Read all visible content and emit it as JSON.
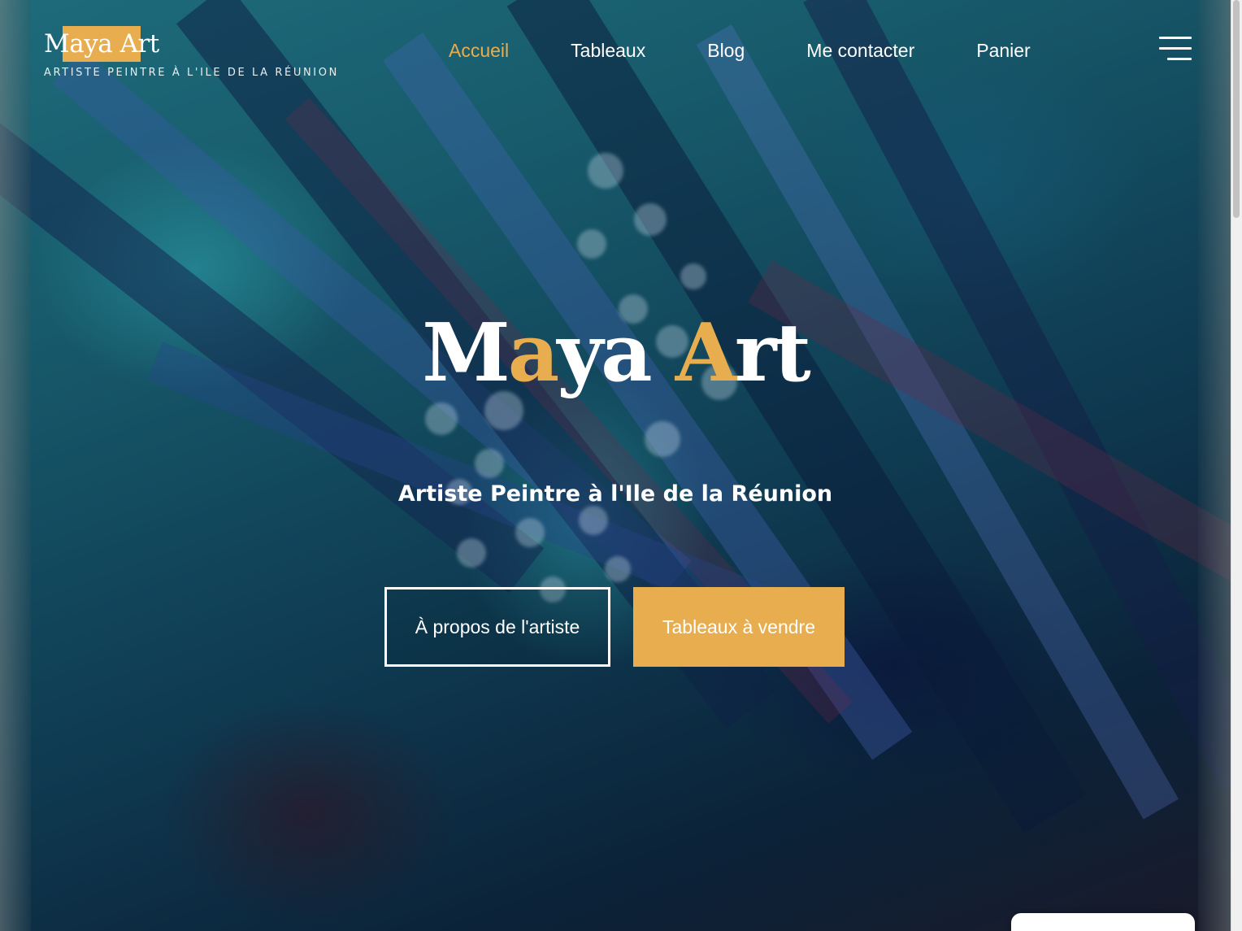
{
  "header": {
    "logo_text": "Maya Art",
    "tagline": "ARTISTE PEINTRE À L'ILE DE LA RÉUNION"
  },
  "nav": {
    "items": [
      {
        "label": "Accueil",
        "active": true
      },
      {
        "label": "Tableaux",
        "active": false
      },
      {
        "label": "Blog",
        "active": false
      },
      {
        "label": "Me contacter",
        "active": false
      },
      {
        "label": "Panier",
        "active": false
      }
    ],
    "menu_icon": "hamburger-icon"
  },
  "hero": {
    "title_parts": [
      "M",
      "a",
      "ya ",
      "A",
      "rt"
    ],
    "subtitle": "Artiste Peintre à l'Ile de la Réunion",
    "primary_button": "À propos de l'artiste",
    "secondary_button": "Tableaux à vendre"
  },
  "colors": {
    "accent": "#e8ad4f",
    "text": "#ffffff",
    "background": "#0f3c53"
  }
}
